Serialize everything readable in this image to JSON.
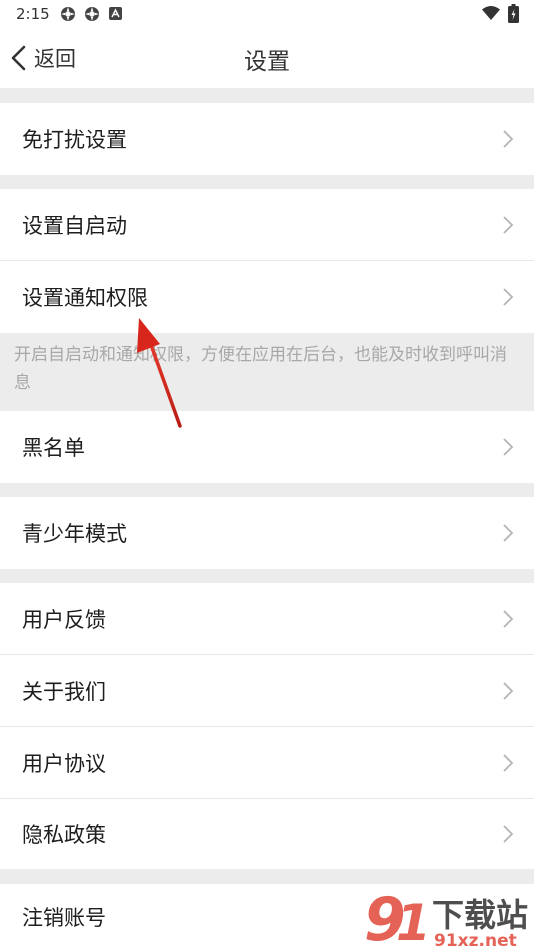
{
  "status_bar": {
    "time": "2:15",
    "icons": [
      "app-notification-icon",
      "app-notification-icon",
      "text-notification-icon",
      "wifi-icon",
      "battery-charging-icon"
    ]
  },
  "nav": {
    "back_label": "返回",
    "title": "设置"
  },
  "settings": {
    "do_not_disturb": "免打扰设置",
    "auto_start": "设置自启动",
    "notification_permission": "设置通知权限",
    "hint": "开启自启动和通知权限，方便在应用在后台，也能及时收到呼叫消息",
    "blacklist": "黑名单",
    "teen_mode": "青少年模式",
    "feedback": "用户反馈",
    "about_us": "关于我们",
    "user_agreement": "用户协议",
    "privacy_policy": "隐私政策",
    "cancel_account": "注销账号"
  },
  "annotation": {
    "arrow_color": "#d9261c"
  },
  "watermark": {
    "logo_text": "下载站",
    "site_text": "91xz.net"
  },
  "colors": {
    "background": "#ececec",
    "row": "#ffffff",
    "text": "#1e1e1e",
    "hint": "#a8a8a8"
  }
}
